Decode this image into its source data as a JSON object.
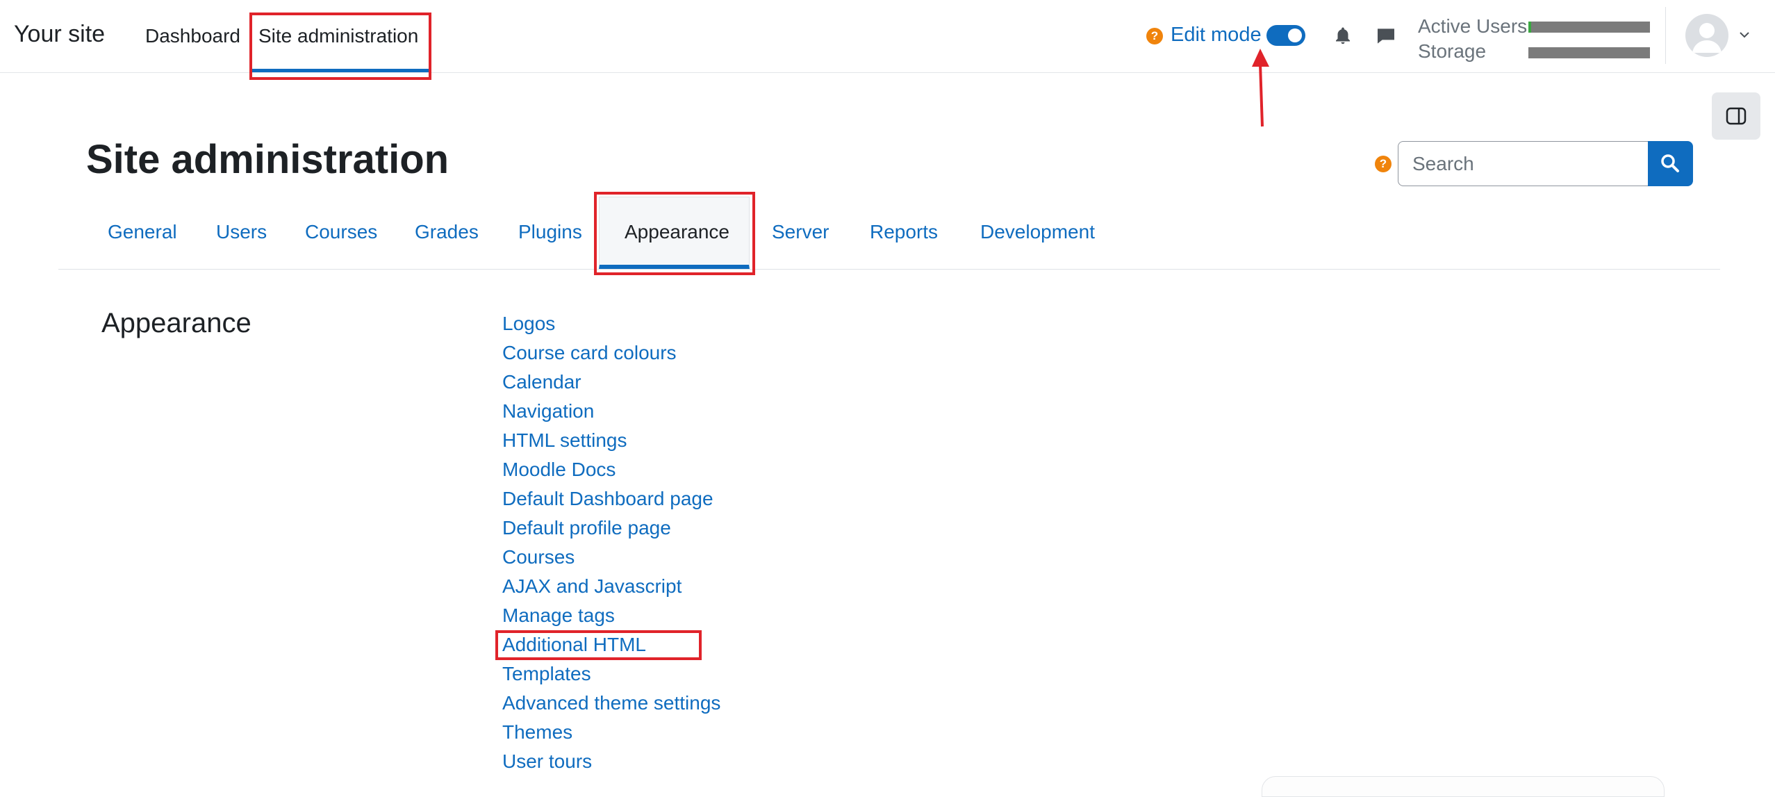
{
  "navbar": {
    "brand": "Your site",
    "items": [
      {
        "label": "Dashboard"
      },
      {
        "label": "Site administration"
      }
    ],
    "edit_mode_label": "Edit mode",
    "edit_mode_on": true,
    "quota": {
      "active_users_label": "Active Users",
      "storage_label": "Storage",
      "active_users_fraction": 0.02,
      "storage_fraction": 0.0
    },
    "icons": {
      "help": "question-circle-icon",
      "notifications": "bell-icon",
      "messages": "chat-bubble-icon",
      "avatar": "user-avatar-icon",
      "menu": "chevron-down-icon"
    }
  },
  "header": {
    "title": "Site administration",
    "search": {
      "placeholder": "Search"
    }
  },
  "tabs": [
    {
      "label": "General"
    },
    {
      "label": "Users"
    },
    {
      "label": "Courses"
    },
    {
      "label": "Grades"
    },
    {
      "label": "Plugins"
    },
    {
      "label": "Appearance",
      "active": true
    },
    {
      "label": "Server"
    },
    {
      "label": "Reports"
    },
    {
      "label": "Development"
    }
  ],
  "section": {
    "heading": "Appearance",
    "links": [
      "Logos",
      "Course card colours",
      "Calendar",
      "Navigation",
      "HTML settings",
      "Moodle Docs",
      "Default Dashboard page",
      "Default profile page",
      "Courses",
      "AJAX and Javascript",
      "Manage tags",
      "Additional HTML",
      "Templates",
      "Advanced theme settings",
      "Themes",
      "User tours"
    ]
  },
  "colors": {
    "brand": "#0f6cbf",
    "help": "#f0840c",
    "annotation": "#e0232a",
    "quota_fill": "#3aa741",
    "quota_track": "#7b7b7b"
  }
}
